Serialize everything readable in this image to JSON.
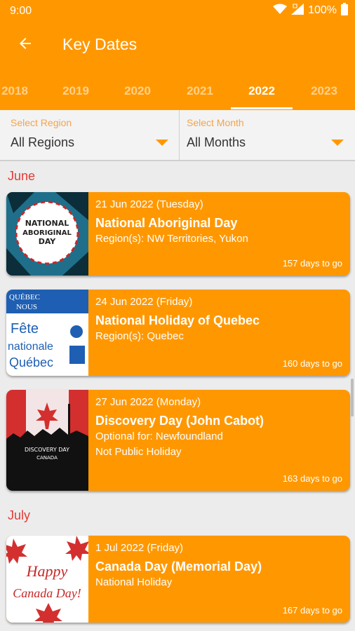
{
  "status_bar": {
    "time": "9:00",
    "battery": "100%"
  },
  "app_bar": {
    "title": "Key Dates"
  },
  "tabs": [
    "2018",
    "2019",
    "2020",
    "2021",
    "2022",
    "2023"
  ],
  "active_tab": "2022",
  "filters": {
    "region": {
      "label": "Select Region",
      "value": "All Regions"
    },
    "month": {
      "label": "Select Month",
      "value": "All Months"
    }
  },
  "months": [
    {
      "name": "June",
      "events": [
        {
          "date": "21 Jun 2022 (Tuesday)",
          "name": "National Aboriginal Day",
          "line1": "Region(s): NW Territories, Yukon",
          "line2": "",
          "countdown": "157 days to go",
          "thumb_text": [
            "NATIONAL",
            "ABORIGINAL",
            "DAY"
          ]
        },
        {
          "date": "24 Jun 2022 (Friday)",
          "name": "National Holiday of Quebec",
          "line1": "Region(s): Quebec",
          "line2": "",
          "countdown": "160 days to go",
          "thumb_text": [
            "QUÉBEC",
            "NOUS",
            "Fête",
            "nationale",
            "Québec"
          ]
        },
        {
          "date": "27 Jun 2022 (Monday)",
          "name": "Discovery Day (John Cabot)",
          "line1": "Optional for: Newfoundland",
          "line2": "Not Public Holiday",
          "countdown": "163 days to go",
          "thumb_text": [
            "DISCOVERY DAY",
            "CANADA"
          ]
        }
      ]
    },
    {
      "name": "July",
      "events": [
        {
          "date": "1 Jul 2022 (Friday)",
          "name": "Canada Day (Memorial Day)",
          "line1": "National Holiday",
          "line2": "",
          "countdown": "167 days to go",
          "thumb_text": [
            "Happy",
            "Canada Day!"
          ]
        }
      ]
    }
  ],
  "colors": {
    "primary": "#ff9800",
    "month_header": "#e53935",
    "background": "#ececec"
  },
  "icons": {
    "back": "arrow-left-icon",
    "dropdown": "caret-down-icon",
    "wifi": "wifi-icon",
    "signal": "signal-icon",
    "battery": "battery-icon"
  }
}
